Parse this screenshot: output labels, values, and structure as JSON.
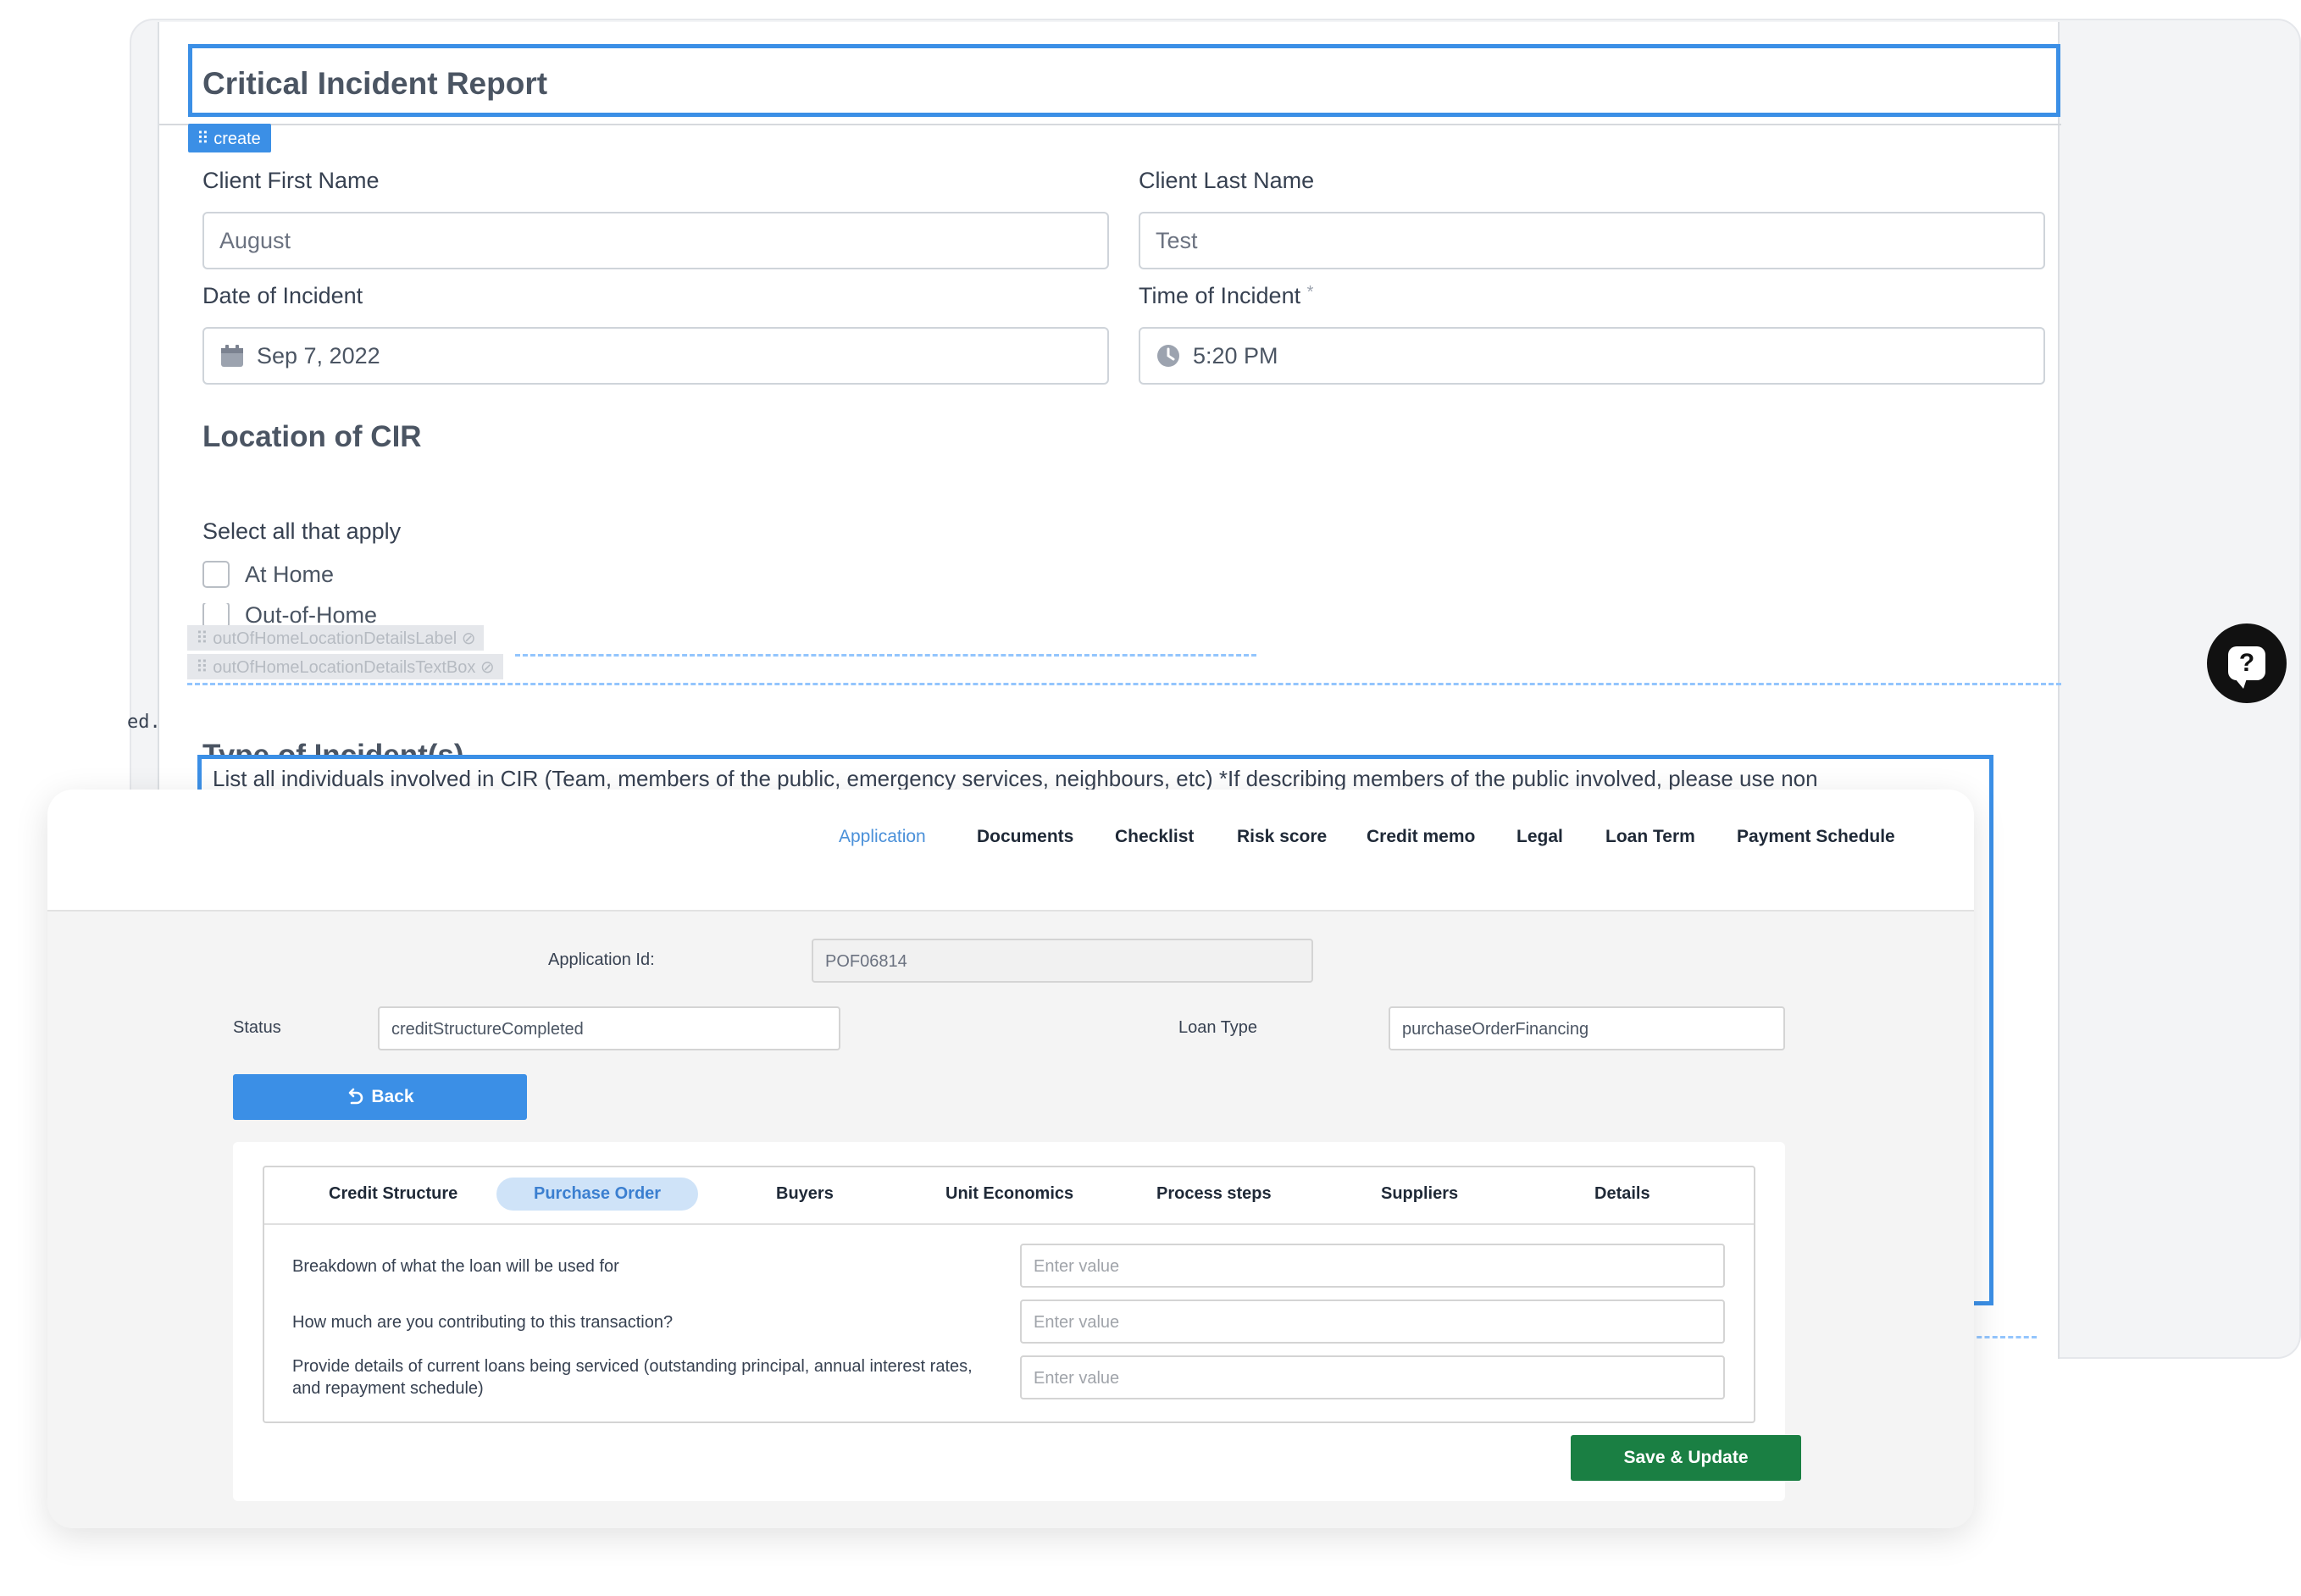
{
  "cir": {
    "title": "Critical Incident Report",
    "create_chip": "⠿ create",
    "first_name_label": "Client First Name",
    "first_name_value": "August",
    "last_name_label": "Client Last Name",
    "last_name_value": "Test",
    "date_label": "Date of Incident",
    "date_value": "Sep 7, 2022",
    "time_label": "Time of Incident",
    "time_required": "*",
    "time_value": "5:20 PM",
    "location_heading": "Location of CIR",
    "select_all_label": "Select all that apply",
    "options": [
      "At Home",
      "Out-of-Home"
    ],
    "ghost_label_chip": "⠿ outOfHomeLocationDetailsLabel ⊘",
    "ghost_textbox_chip": "⠿ outOfHomeLocationDetailsTextBox ⊘",
    "side_fragment": "ed.",
    "incident_heading": "Type of Incident(s)",
    "incident_description": "List all individuals involved in CIR (Team, members of the public, emergency services, neighbours, etc) *If describing members of the public involved, please use non"
  },
  "loan": {
    "nav_tabs": [
      "Application",
      "Documents",
      "Checklist",
      "Risk score",
      "Credit memo",
      "Legal",
      "Loan Term",
      "Payment Schedule"
    ],
    "app_id_label": "Application Id:",
    "app_id_value": "POF06814",
    "status_label": "Status",
    "status_value": "creditStructureCompleted",
    "loan_type_label": "Loan Type",
    "loan_type_value": "purchaseOrderFinancing",
    "back_label": "Back",
    "sub_tabs": [
      "Credit Structure",
      "Purchase Order",
      "Buyers",
      "Unit Economics",
      "Process steps",
      "Suppliers",
      "Details"
    ],
    "questions": [
      "Breakdown of what the loan will be used for",
      "How much are you contributing to this transaction?",
      "Provide details of current loans being serviced (outstanding principal, annual interest rates, and repayment schedule)"
    ],
    "input_placeholder": "Enter value",
    "save_label": "Save & Update"
  },
  "help": {
    "glyph": "?"
  },
  "colors": {
    "accent": "#3b8fe6",
    "save_green": "#1a7f43"
  }
}
